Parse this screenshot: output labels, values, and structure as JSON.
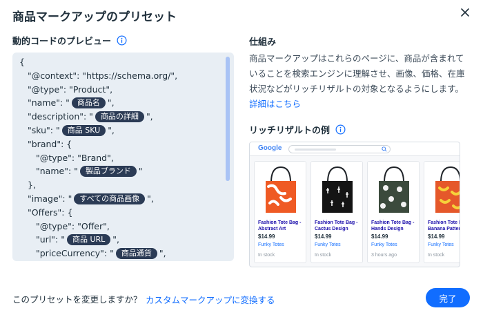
{
  "dialog": {
    "title": "商品マークアップのプリセット"
  },
  "left": {
    "label": "動的コードのプレビュー"
  },
  "code": {
    "l1": "{",
    "l2": "\"@context\": \"https://schema.org/\",",
    "l3": "\"@type\": \"Product\",",
    "l4_key": "\"name\": \"",
    "l4_chip": "商品名",
    "l4_end": "\",",
    "l5_key": "\"description\": \"",
    "l5_chip": "商品の詳細",
    "l5_end": "\",",
    "l6_key": "\"sku\": \"",
    "l6_chip": "商品 SKU",
    "l6_end": "\",",
    "l7": "\"brand\": {",
    "l8": "\"@type\": \"Brand\",",
    "l9_key": "\"name\": \"",
    "l9_chip": "製品ブランド",
    "l9_end": "\"",
    "l10": "},",
    "l11_key": "\"image\": \"",
    "l11_chip": "すべての商品画像",
    "l11_end": "\",",
    "l12": "\"Offers\": {",
    "l13": "\"@type\": \"Offer\",",
    "l14_key": "\"url\": \"",
    "l14_chip": "商品 URL",
    "l14_end": "\",",
    "l15_key": "\"priceCurrency\": \"",
    "l15_chip": "商品通貨",
    "l15_end": "\","
  },
  "right": {
    "title": "仕組み",
    "desc": "商品マークアップはこれらのページに、商品が含まれていることを検索エンジンに理解させ、画像、価格、在庫状況などがリッチリザルトの対象となるようにします。",
    "link": "詳細はこちら",
    "rich_label": "リッチリザルトの例"
  },
  "preview": {
    "logo": "Google",
    "cards": [
      {
        "title": "Fashion Tote Bag - Abstract Art",
        "price": "$14.99",
        "store": "Funky Totes",
        "stock": "In stock"
      },
      {
        "title": "Fashion Tote Bag - Cactus Design",
        "price": "$14.99",
        "store": "Funky Totes",
        "stock": "In stock"
      },
      {
        "title": "Fashion Tote Bag - Hands Design",
        "price": "$14.99",
        "store": "Funky Totes",
        "stock": "3 hours ago"
      },
      {
        "title": "Fashion Tote Bag - Banana Pattern",
        "price": "$14.99",
        "store": "Funky Totes",
        "stock": "In stock"
      }
    ]
  },
  "footer": {
    "question": "このプリセットを変更しますか？",
    "link": "カスタムマークアップに変換する",
    "done": "完了"
  },
  "colors": {
    "accent": "#116dff",
    "chip": "#2b3b55",
    "code_bg": "#e8eef4"
  }
}
